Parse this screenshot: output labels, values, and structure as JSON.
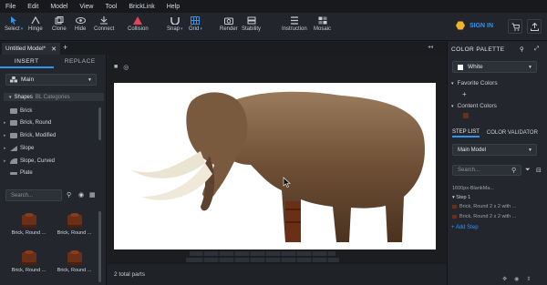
{
  "menu": [
    "File",
    "Edit",
    "Model",
    "View",
    "Tool",
    "BrickLink",
    "Help"
  ],
  "toolbar": {
    "tools": [
      {
        "label": "Select",
        "icon": "cursor-icon",
        "caret": true
      },
      {
        "label": "Hinge",
        "icon": "hinge-icon"
      },
      {
        "label": "Clone",
        "icon": "clone-icon"
      },
      {
        "label": "Hide",
        "icon": "eye-icon"
      },
      {
        "label": "Connect",
        "icon": "connect-icon"
      },
      {
        "label": "Collision",
        "icon": "collision-icon"
      },
      {
        "label": "Snap",
        "icon": "snap-icon",
        "caret": true
      },
      {
        "label": "Grid",
        "icon": "grid-icon",
        "caret": true
      },
      {
        "label": "Render",
        "icon": "camera-icon"
      },
      {
        "label": "Stability",
        "icon": "stability-icon"
      },
      {
        "label": "Instruction",
        "icon": "instruction-icon"
      },
      {
        "label": "Mosaic",
        "icon": "mosaic-icon"
      }
    ],
    "sign_in": "SIGN IN"
  },
  "tabs": {
    "model_tab": "Untitled Model*"
  },
  "left_panel": {
    "tab_insert": "INSERT",
    "tab_replace": "REPLACE",
    "dropdown": "Main",
    "category_header_a": "Shapes",
    "category_header_b": "BL Categories",
    "categories": [
      "Brick",
      "Brick, Round",
      "Brick, Modified",
      "Slope",
      "Slope, Curved",
      "Plate"
    ],
    "search_placeholder": "Search...",
    "parts": [
      "Brick, Round ...",
      "Brick, Round ...",
      "Brick, Round ...",
      "Brick, Round ..."
    ]
  },
  "viewport": {
    "status": "2 total parts"
  },
  "right_panel": {
    "color_palette": "COLOR PALETTE",
    "selected_color": "White",
    "favorite_colors": "Favorite Colors",
    "content_colors": "Content Colors",
    "step_list_tab": "STEP LIST",
    "color_validator_tab": "COLOR VALIDATOR",
    "main_model": "Main Model",
    "search_placeholder": "Search...",
    "file_name": "1600px-BlankMa...",
    "step_label": "Step 1",
    "step_items": [
      "Brick, Round 2 x 2 with ...",
      "Brick, Round 2 x 2 with ..."
    ],
    "add_step": "+ Add Step"
  },
  "colors": {
    "accent": "#2f95ef",
    "brick_brown": "#6b2f17",
    "sign_in_hex": "#f0b429"
  }
}
